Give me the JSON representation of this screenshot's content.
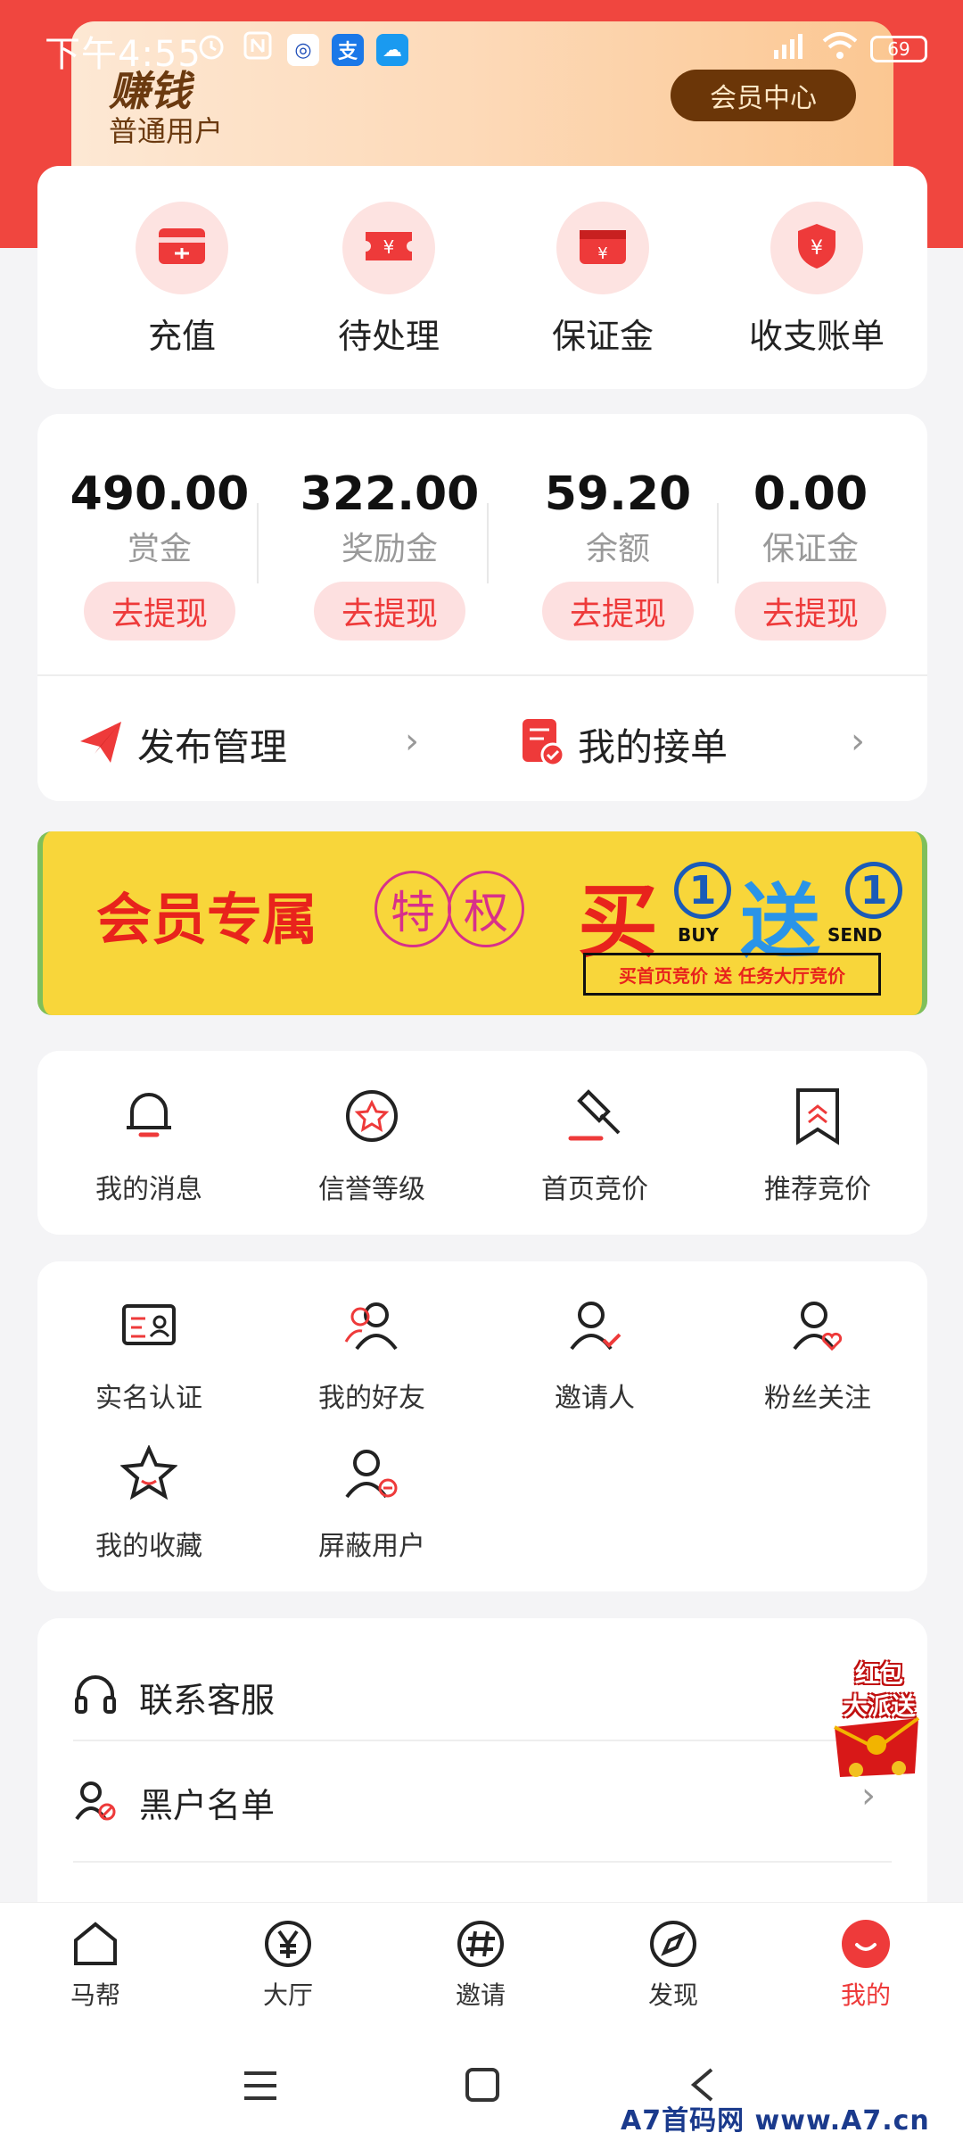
{
  "status_bar": {
    "time": "下午4:55",
    "battery": "69"
  },
  "header": {
    "title": "赚钱",
    "user_type": "普通用户",
    "member_center": "会员中心"
  },
  "quick_actions": [
    {
      "label": "充值",
      "icon": "card-icon"
    },
    {
      "label": "待处理",
      "icon": "ticket-icon"
    },
    {
      "label": "保证金",
      "icon": "wallet-icon"
    },
    {
      "label": "收支账单",
      "icon": "shield-yen-icon"
    }
  ],
  "balances": [
    {
      "value": "490.00",
      "label": "赏金",
      "button": "去提现"
    },
    {
      "value": "322.00",
      "label": "奖励金",
      "button": "去提现"
    },
    {
      "value": "59.20",
      "label": "余额",
      "button": "去提现"
    },
    {
      "value": "0.00",
      "label": "保证金",
      "button": "去提现"
    }
  ],
  "shortcuts": {
    "publish": "发布管理",
    "orders": "我的接单"
  },
  "banner": {
    "main": "会员专属",
    "te": "特",
    "quan": "权",
    "buy": "买",
    "send": "送",
    "one": "1",
    "buy_en": "BUY",
    "send_en": "SEND",
    "sub": "买首页竞价 送 任务大厅竞价"
  },
  "grid1": [
    {
      "label": "我的消息"
    },
    {
      "label": "信誉等级"
    },
    {
      "label": "首页竞价"
    },
    {
      "label": "推荐竞价"
    }
  ],
  "grid2": [
    {
      "label": "实名认证"
    },
    {
      "label": "我的好友"
    },
    {
      "label": "邀请人"
    },
    {
      "label": "粉丝关注"
    },
    {
      "label": "我的收藏"
    },
    {
      "label": "屏蔽用户"
    }
  ],
  "list": {
    "service": "联系客服",
    "blacklist": "黑户名单"
  },
  "hongbao": {
    "line1": "红包",
    "line2": "大派送"
  },
  "tabs": [
    {
      "label": "马帮"
    },
    {
      "label": "大厅"
    },
    {
      "label": "邀请"
    },
    {
      "label": "发现"
    },
    {
      "label": "我的"
    }
  ],
  "watermark": "A7首码网  www.A7.cn",
  "colors": {
    "primary": "#ee3a3a",
    "header_bg": "#f0463f",
    "member_btn": "#6b3608",
    "banner_bg": "#f8d63a"
  }
}
